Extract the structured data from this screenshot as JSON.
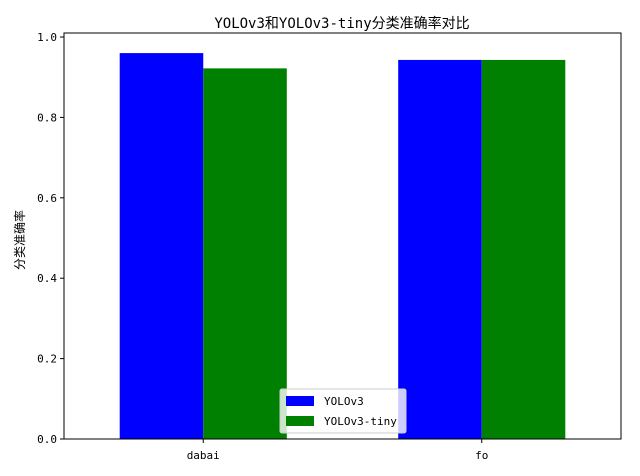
{
  "chart_data": {
    "type": "bar",
    "title": "YOLOv3和YOLOv3-tiny分类准确率对比",
    "xlabel": "",
    "ylabel": "分类准确率",
    "categories": [
      "dabai",
      "fo"
    ],
    "series": [
      {
        "name": "YOLOv3",
        "values": [
          0.96,
          0.943
        ],
        "color": "#0000ff"
      },
      {
        "name": "YOLOv3-tiny",
        "values": [
          0.922,
          0.943
        ],
        "color": "#008000"
      }
    ],
    "ylim": [
      0,
      1.01
    ],
    "yticks": [
      "0.0",
      "0.2",
      "0.4",
      "0.6",
      "0.8",
      "1.0"
    ],
    "grid": false,
    "legend_position": "bottom-center"
  }
}
